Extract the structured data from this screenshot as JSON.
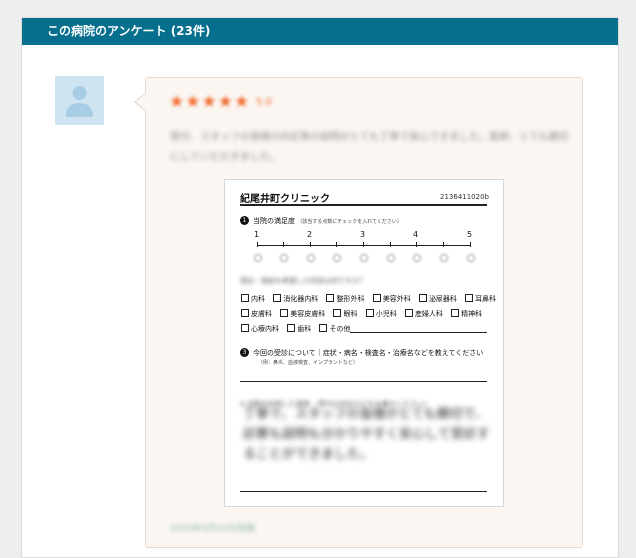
{
  "panel": {
    "title": "この病院のアンケート (23件)"
  },
  "review": {
    "stars": [
      "★",
      "★",
      "★",
      "★",
      "★"
    ],
    "score": "5.0",
    "comment": "受付、スタッフの皆様の対応等の説明がとても丁寧で安心できました。医師、とても親切にしていただきました。",
    "date": "2023年4月10日投稿",
    "colors": {
      "star": "#f26a2c",
      "header": "#066f8e"
    }
  },
  "sheet": {
    "clinic_name": "紀尾井町クリニック",
    "sheet_id": "2136411020b",
    "q1": {
      "num": "1",
      "label": "当院の満足度",
      "sub": "（該当する点数にチェックを入れてください）"
    },
    "scale": [
      "1",
      "2",
      "3",
      "4",
      "5"
    ],
    "q2_blurred": "受診・相談を希望した科目は何ですか？",
    "departments_row1": [
      "内科",
      "消化器内科",
      "整形外科",
      "美容外科",
      "泌尿器科",
      "耳鼻科"
    ],
    "departments_row2": [
      "皮膚科",
      "美容皮膚科",
      "眼科",
      "小児科",
      "産婦人科",
      "精神科"
    ],
    "departments_row3": [
      "心療内科",
      "歯科",
      "その他"
    ],
    "q3": {
      "num": "3",
      "label": "今回の受診について｜症状・病名・検査名・治療名などを教えてください",
      "sub": "（例：鼻炎、血液検査、インプラントなど）"
    },
    "q4": {
      "num": "4",
      "label": "当院を利用した感想",
      "sub": "（受付の対応などもお書きください）"
    },
    "handwriting": "丁寧で、スタッフの皆様がとても親切で、診察も説明も分かりやすく安心して受診することができました。"
  }
}
